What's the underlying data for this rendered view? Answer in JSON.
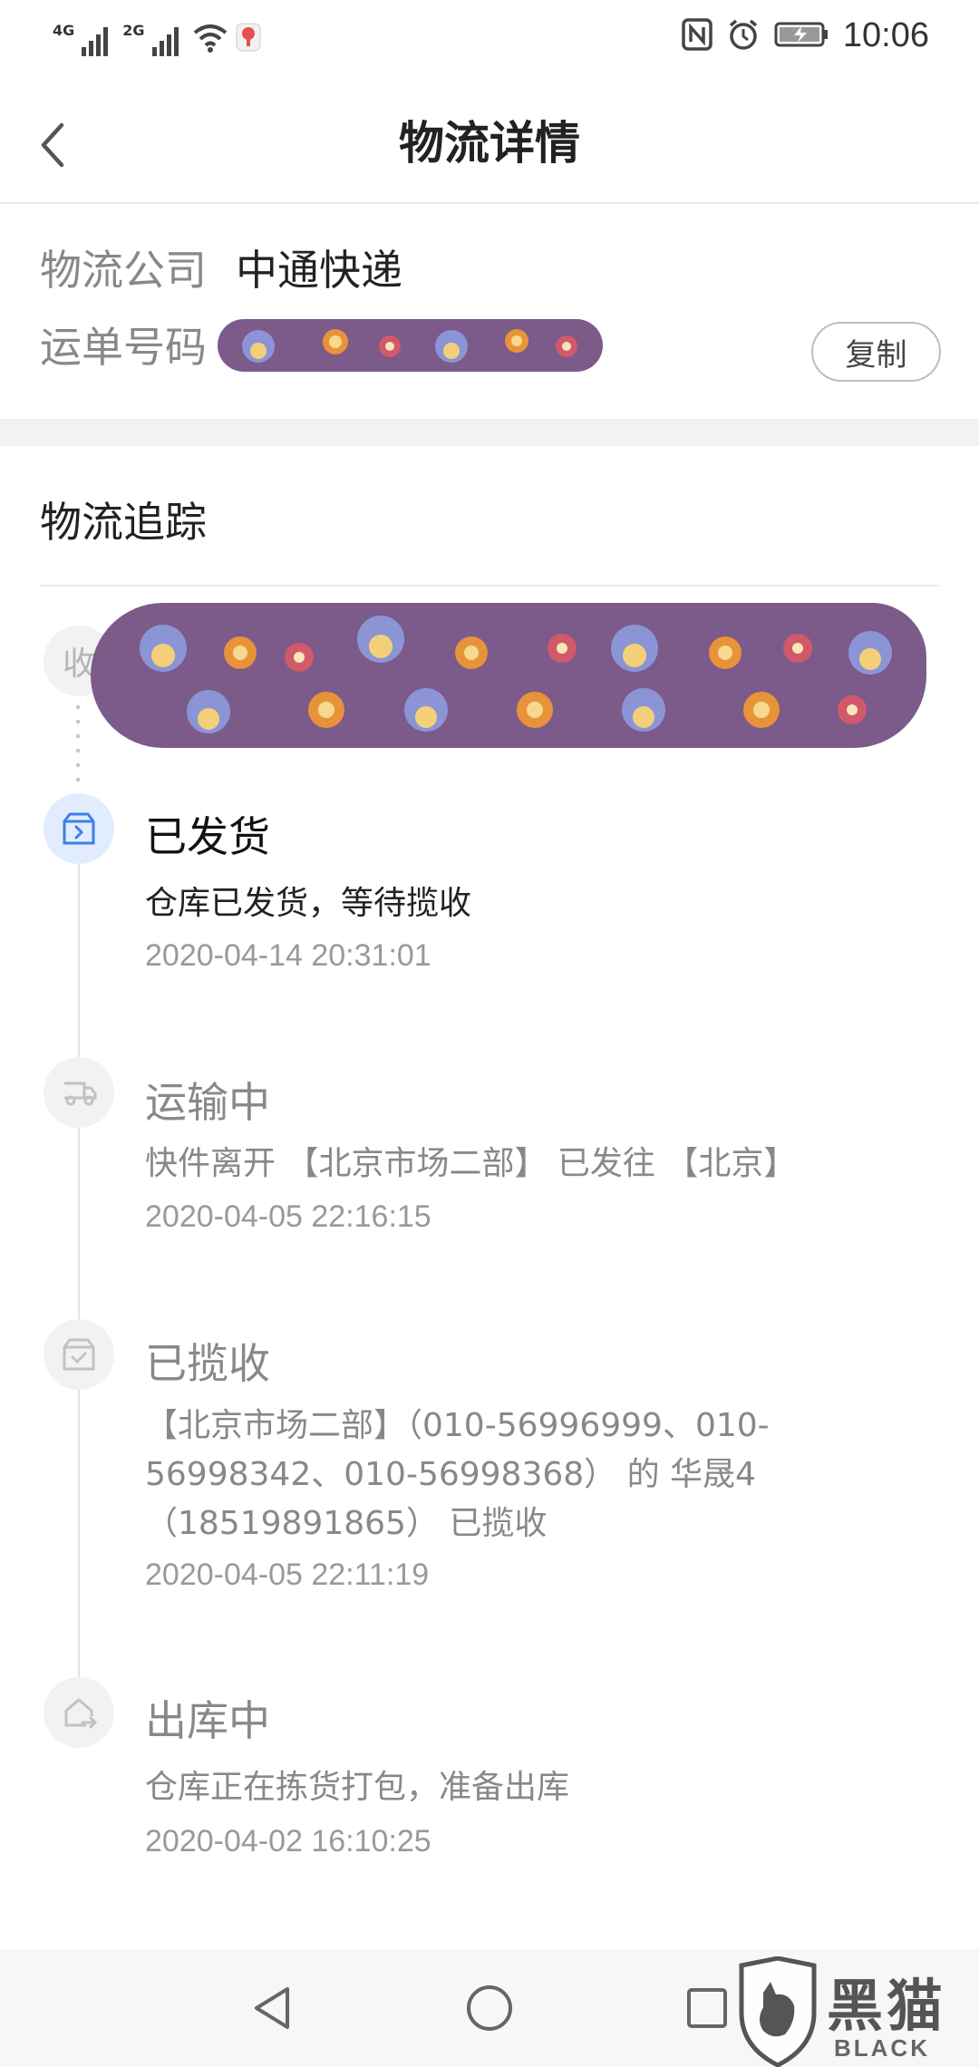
{
  "status_bar": {
    "network1": "4G",
    "network2": "2G",
    "time": "10:06",
    "icons": [
      "signal-4g-icon",
      "signal-2g-icon",
      "wifi-icon",
      "location-app-icon",
      "nfc-icon",
      "alarm-icon",
      "battery-charging-icon"
    ]
  },
  "header": {
    "title": "物流详情",
    "back_icon": "chevron-left-icon"
  },
  "info": {
    "company_label": "物流公司",
    "company_value": "中通快递",
    "waybill_label": "运单号码",
    "copy_label": "复制"
  },
  "tracking": {
    "title": "物流追踪",
    "receive_badge": "收",
    "events": [
      {
        "title": "已发货",
        "desc": "仓库已发货，等待揽收",
        "time": "2020-04-14 20:31:01",
        "icon": "box-arrow-icon",
        "active": true
      },
      {
        "title": "运输中",
        "desc": "快件离开 【北京市场二部】 已发往 【北京】",
        "time": "2020-04-05 22:16:15",
        "icon": "truck-icon",
        "active": false
      },
      {
        "title": "已揽收",
        "desc": "【北京市场二部】（010-56996999、010-56998342、010-56998368） 的 华晟4（18519891865） 已揽收",
        "time": "2020-04-05 22:11:19",
        "icon": "box-check-icon",
        "active": false
      },
      {
        "title": "出库中",
        "desc": "仓库正在拣货打包，准备出库",
        "time": "2020-04-02 16:10:25",
        "icon": "warehouse-out-icon",
        "active": false
      }
    ]
  },
  "watermark": {
    "cn": "黑猫",
    "en": "BLACK CAT"
  },
  "colors": {
    "accent": "#3d7fe6",
    "active_node_bg": "#e1edff",
    "redaction": "#7c5a8a"
  }
}
